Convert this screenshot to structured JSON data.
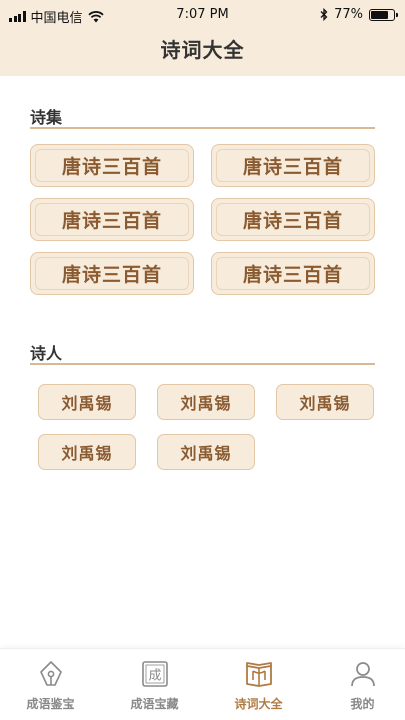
{
  "status_bar": {
    "carrier": "中国电信",
    "time": "7:07 PM",
    "battery_percent": "77%",
    "battery_level": 0.77
  },
  "header": {
    "title": "诗词大全"
  },
  "poems_section": {
    "title": "诗集",
    "items": [
      "唐诗三百首",
      "唐诗三百首",
      "唐诗三百首",
      "唐诗三百首",
      "唐诗三百首",
      "唐诗三百首"
    ]
  },
  "poets_section": {
    "title": "诗人",
    "items": [
      "刘禹锡",
      "刘禹锡",
      "刘禹锡",
      "刘禹锡",
      "刘禹锡"
    ]
  },
  "tabbar": {
    "items": [
      {
        "label": "成语鉴宝",
        "icon": "pen-nib-icon",
        "active": false
      },
      {
        "label": "成语宝藏",
        "icon": "cheng-seal-icon",
        "active": false
      },
      {
        "label": "诗词大全",
        "icon": "book-icon",
        "active": true
      },
      {
        "label": "我的",
        "icon": "person-icon",
        "active": false
      }
    ],
    "seal_char": "成"
  },
  "colors": {
    "header_bg": "#f7ebdc",
    "button_bg": "#f7ebdc",
    "button_text": "#8a5a30",
    "accent": "#b07a44",
    "divider": "#d9b896"
  }
}
